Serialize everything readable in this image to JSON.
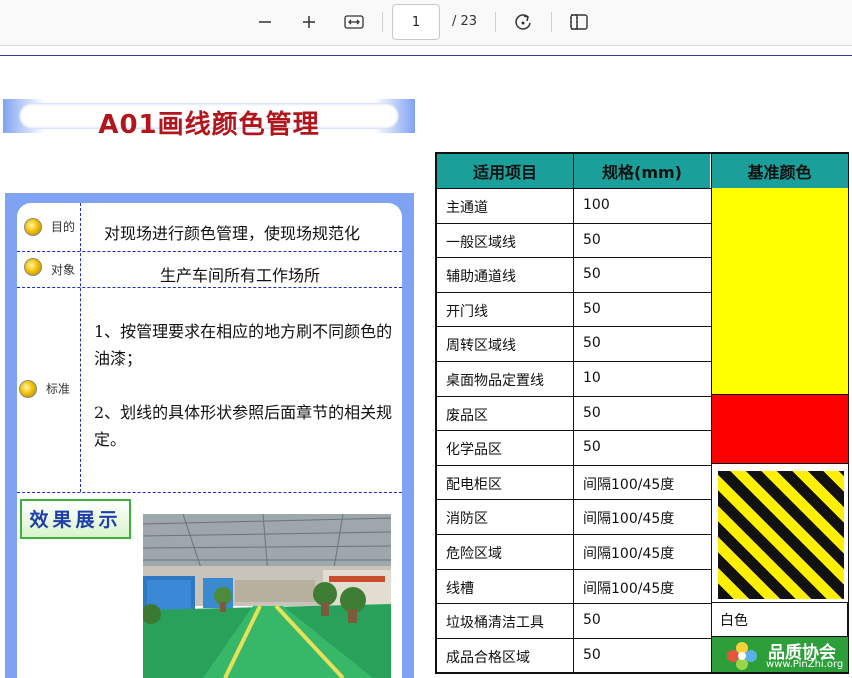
{
  "toolbar": {
    "zoom_out_icon": "minus-icon",
    "zoom_in_icon": "plus-icon",
    "fit_icon": "fit-width-icon",
    "page_current": "1",
    "page_total": "/ 23",
    "rotate_icon": "rotate-icon",
    "more_icon": "document-properties-icon"
  },
  "doc": {
    "title": "A01画线颜色管理",
    "rows": [
      {
        "label": "目的",
        "text": "对现场进行颜色管理，使现场规范化"
      },
      {
        "label": "对象",
        "text": "生产车间所有工作场所"
      },
      {
        "label": "标准",
        "paragraphs": [
          "1、按管理要求在相应的地方刷不同颜色的油漆；",
          "2、划线的具体形状参照后面章节的相关规定。"
        ]
      }
    ],
    "effect_label": "效果展示"
  },
  "table": {
    "headers": [
      "适用项目",
      "规格(mm)",
      "基准颜色"
    ],
    "rows": [
      {
        "item": "主通道",
        "spec": "100"
      },
      {
        "item": "一般区域线",
        "spec": "50"
      },
      {
        "item": "辅助通道线",
        "spec": "50"
      },
      {
        "item": "开门线",
        "spec": "50"
      },
      {
        "item": "周转区域线",
        "spec": "50"
      },
      {
        "item": "桌面物品定置线",
        "spec": "10"
      },
      {
        "item": "废品区",
        "spec": "50"
      },
      {
        "item": "化学品区",
        "spec": "50"
      },
      {
        "item": "配电柜区",
        "spec": "间隔100/45度"
      },
      {
        "item": "消防区",
        "spec": "间隔100/45度"
      },
      {
        "item": "危险区域",
        "spec": "间隔100/45度"
      },
      {
        "item": "线槽",
        "spec": "间隔100/45度"
      },
      {
        "item": "垃圾桶清洁工具",
        "spec": "50"
      },
      {
        "item": "成品合格区域",
        "spec": "50"
      }
    ],
    "white_color_label": "白色",
    "colors": {
      "yellow": "#ffff00",
      "red": "#ff0000",
      "stripe_black": "#111111",
      "stripe_yellow": "#ffef00",
      "header": "#1a9f9a"
    }
  },
  "watermark": {
    "name": "品质协会",
    "url": "www.PinZhi.org"
  }
}
